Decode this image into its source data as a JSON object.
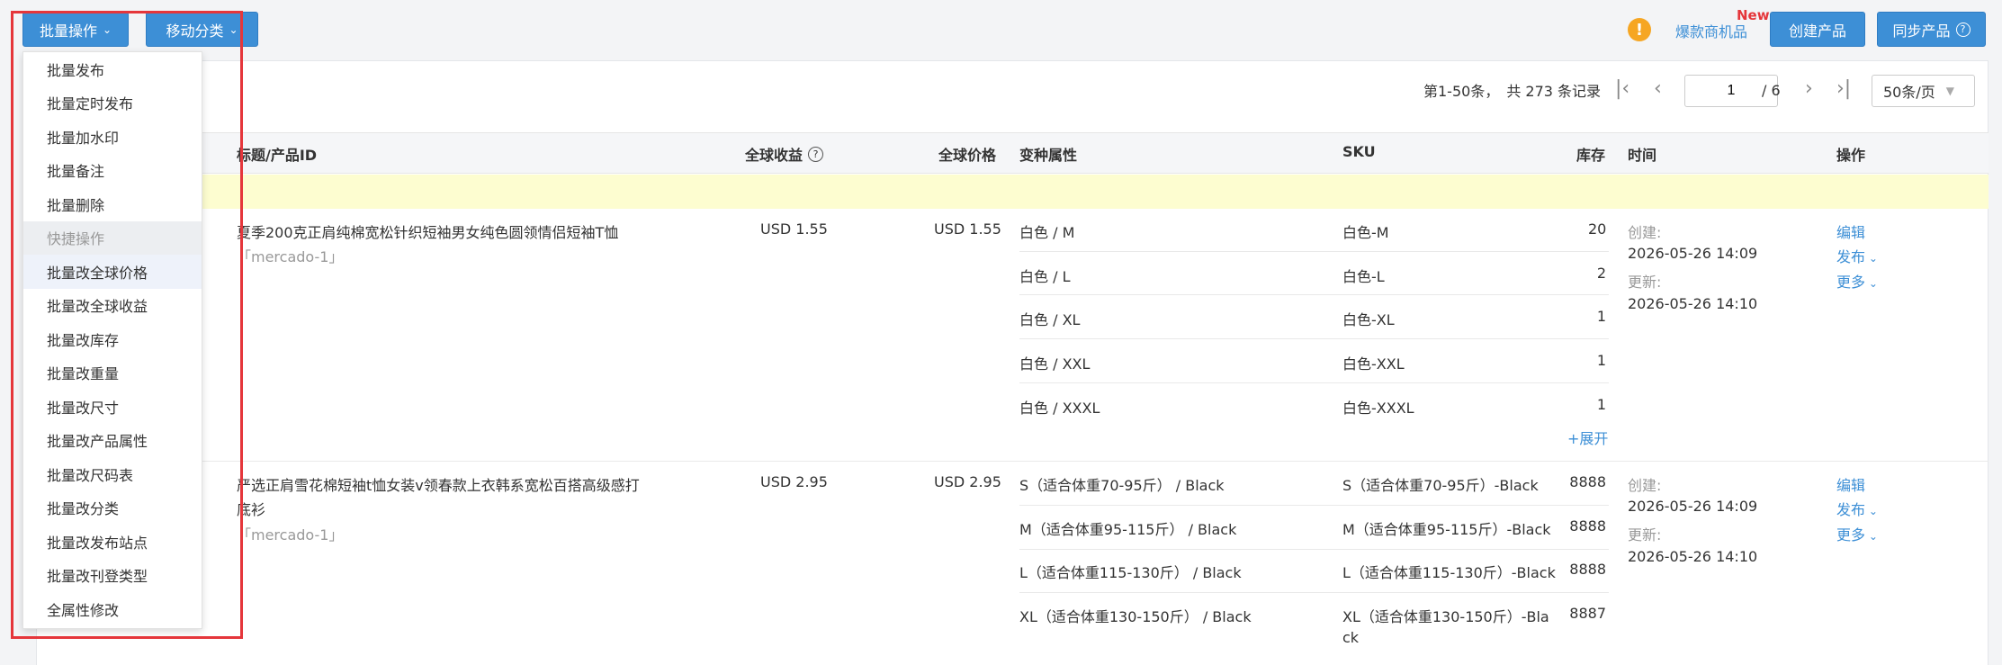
{
  "toolbar": {
    "bulk_ops_label": "批量操作",
    "move_category_label": "移动分类",
    "hot_products_label": "爆款商机品",
    "new_badge": "New",
    "create_product_label": "创建产品",
    "sync_product_label": "同步产品",
    "warn_symbol": "!",
    "help_symbol": "?"
  },
  "pager": {
    "range_text": "第1-50条，",
    "total_text": "共 273 条记录",
    "current_page": "1",
    "total_pages": "/ 6",
    "page_size": "50条/页"
  },
  "columns": {
    "title": "标题/产品ID",
    "global_profit": "全球收益",
    "global_price": "全球价格",
    "variant_attrs": "变种属性",
    "sku": "SKU",
    "stock": "库存",
    "time": "时间",
    "actions": "操作"
  },
  "rows": [
    {
      "title": "夏季200克正肩纯棉宽松针织短袖男女纯色圆领情侣短袖T恤",
      "store": "「mercado-1」",
      "profit": "USD 1.55",
      "price": "USD 1.55",
      "variants": [
        {
          "attr": "白色 / M",
          "sku": "白色-M",
          "stock": "20"
        },
        {
          "attr": "白色 / L",
          "sku": "白色-L",
          "stock": "2"
        },
        {
          "attr": "白色 / XL",
          "sku": "白色-XL",
          "stock": "1"
        },
        {
          "attr": "白色 / XXL",
          "sku": "白色-XXL",
          "stock": "1"
        },
        {
          "attr": "白色 / XXXL",
          "sku": "白色-XXXL",
          "stock": "1"
        }
      ],
      "expand": "+展开",
      "created_label": "创建:",
      "created": "2026-05-26 14:09",
      "updated_label": "更新:",
      "updated": "2026-05-26 14:10",
      "edit": "编辑",
      "publish": "发布",
      "more": "更多"
    },
    {
      "title_line1": "严选正肩雪花棉短袖t恤女装v领春款上衣韩系宽松百搭高级感打",
      "title_line2": "底衫",
      "store": "「mercado-1」",
      "profit": "USD 2.95",
      "price": "USD 2.95",
      "variants": [
        {
          "attr": "S（适合体重70-95斤） / Black",
          "sku": "S（适合体重70-95斤）-Black",
          "stock": "8888"
        },
        {
          "attr": "M（适合体重95-115斤） / Black",
          "sku": "M（适合体重95-115斤）-Black",
          "stock": "8888"
        },
        {
          "attr": "L（适合体重115-130斤） / Black",
          "sku": "L（适合体重115-130斤）-Black",
          "stock": "8888"
        },
        {
          "attr": "XL（适合体重130-150斤） / Black",
          "sku_line1": "XL（适合体重130-150斤）-Bla",
          "sku_line2": "ck",
          "stock": "8887"
        }
      ],
      "created_label": "创建:",
      "created": "2026-05-26 14:09",
      "updated_label": "更新:",
      "updated": "2026-05-26 14:10",
      "edit": "编辑",
      "publish": "发布",
      "more": "更多"
    }
  ],
  "menu": {
    "items": [
      "批量发布",
      "批量定时发布",
      "批量加水印",
      "批量备注",
      "批量删除"
    ],
    "section_label": "快捷操作",
    "quick_items": [
      "批量改全球价格",
      "批量改全球收益",
      "批量改库存",
      "批量改重量",
      "批量改尺寸",
      "批量改产品属性",
      "批量改尺码表",
      "批量改分类",
      "批量改发布站点",
      "批量改刊登类型",
      "全属性修改"
    ]
  },
  "colors": {
    "primary": "#3d8fd6",
    "highlight_border": "#e5363b",
    "warning": "#f6a623",
    "yellow_row": "#fdfdd0"
  }
}
